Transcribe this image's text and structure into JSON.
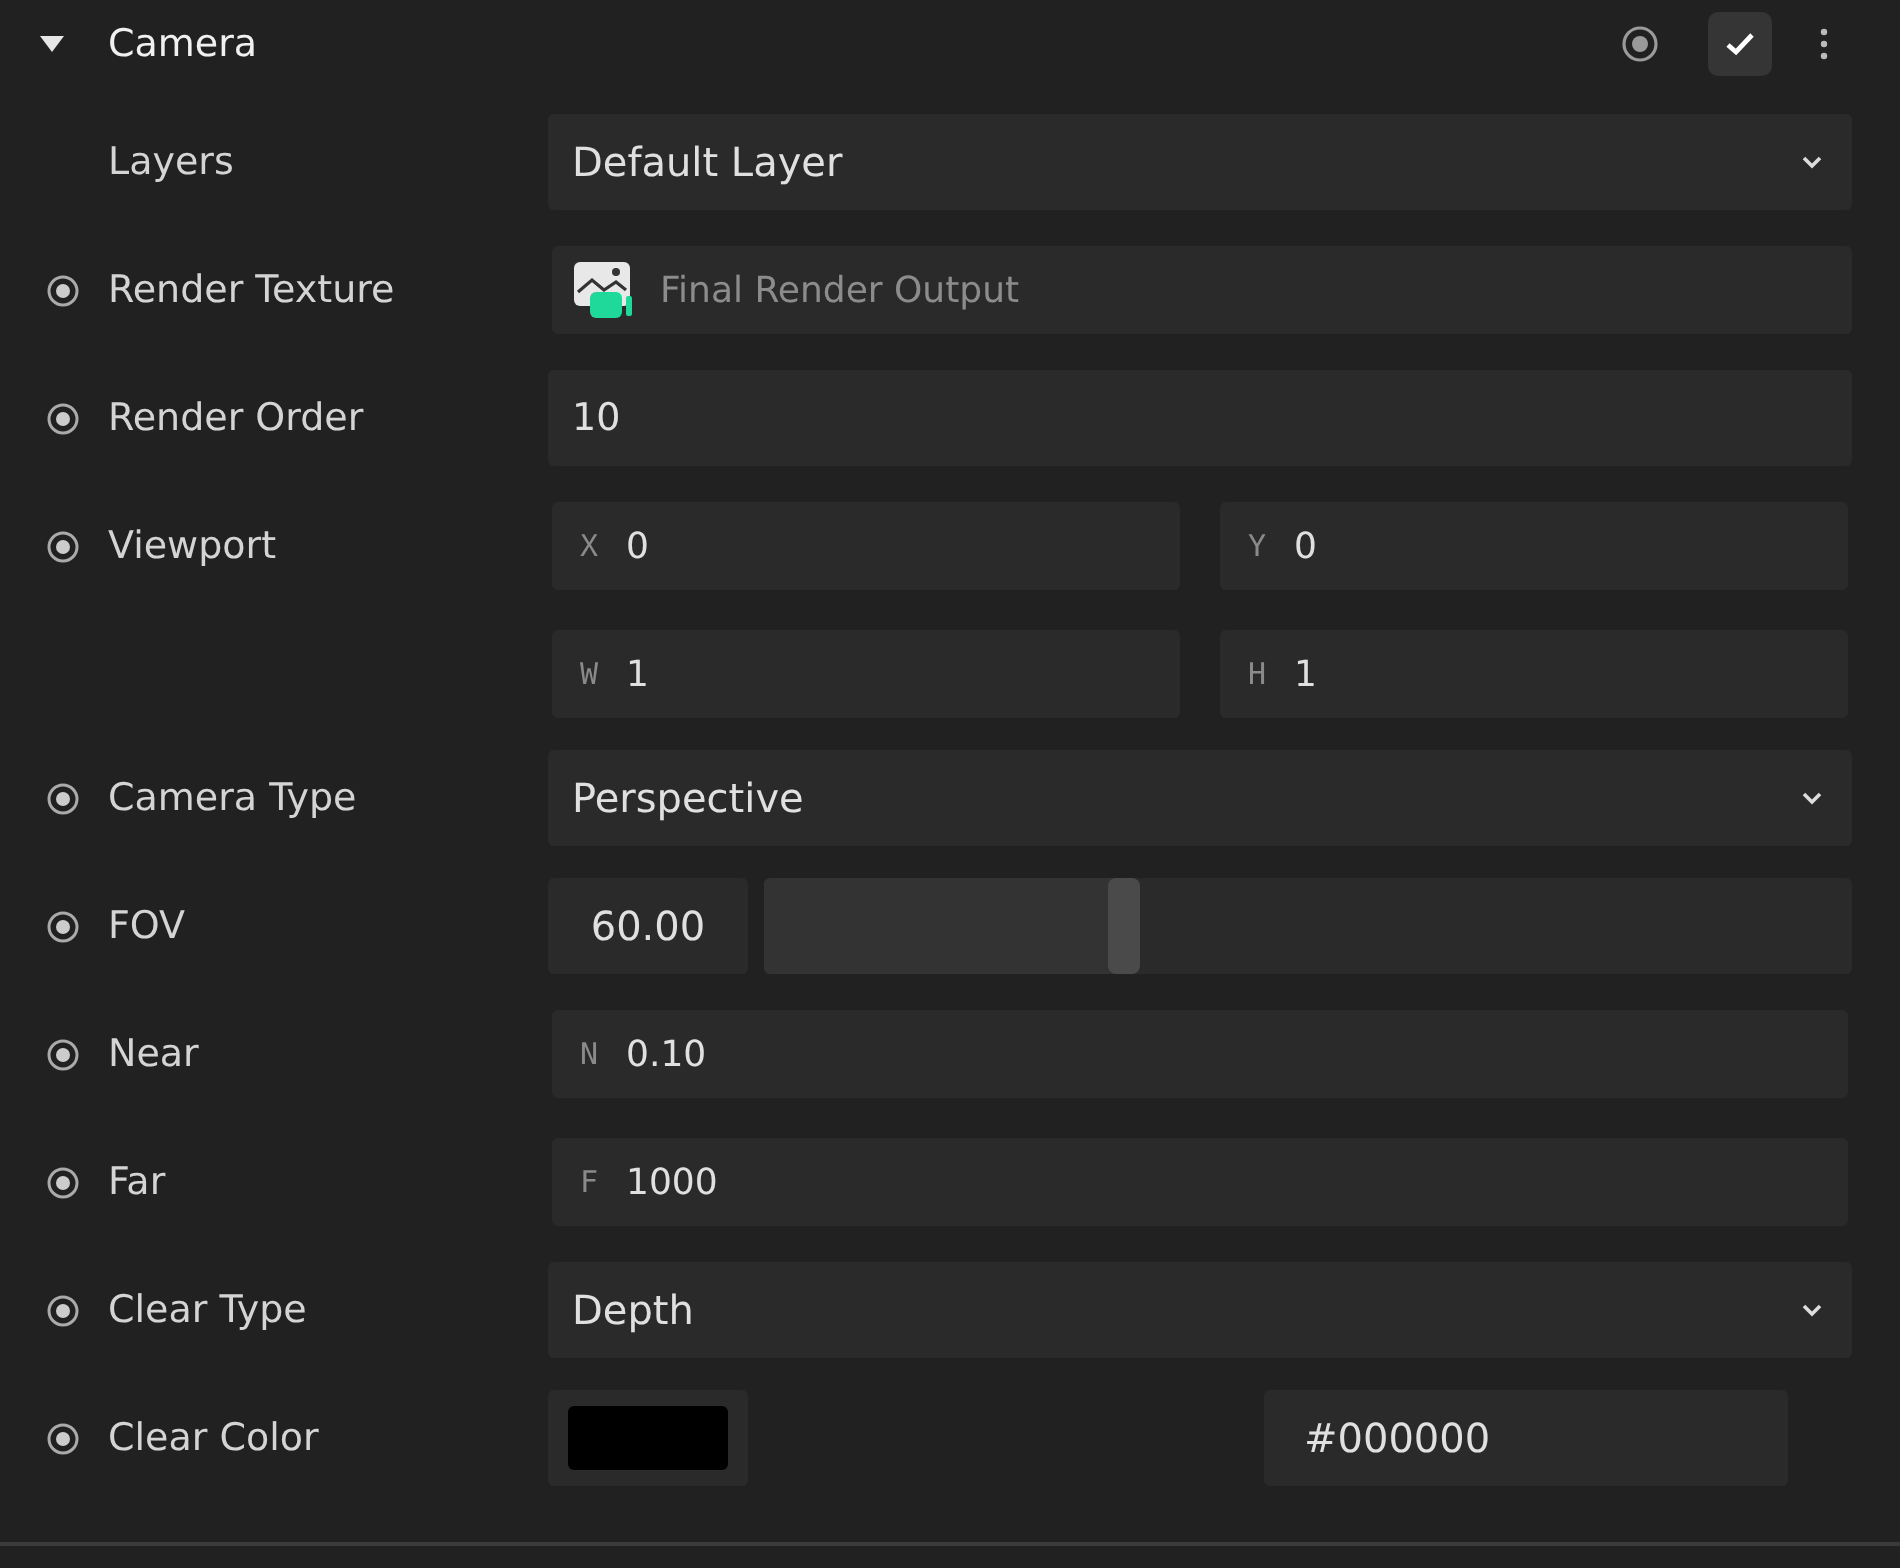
{
  "header": {
    "title": "Camera",
    "expanded": true,
    "enabled": true
  },
  "rows": [
    {
      "kind": "dropdown",
      "label": "Layers",
      "marker": false,
      "value": "Default Layer"
    },
    {
      "kind": "asset",
      "label": "Render Texture",
      "marker": true,
      "value": "Final Render Output"
    },
    {
      "kind": "number",
      "label": "Render Order",
      "marker": true,
      "value": "10"
    },
    {
      "kind": "vector",
      "label": "Viewport",
      "marker": true,
      "fields": [
        {
          "axis": "X",
          "value": "0"
        },
        {
          "axis": "Y",
          "value": "0"
        },
        {
          "axis": "W",
          "value": "1"
        },
        {
          "axis": "H",
          "value": "1"
        }
      ]
    },
    {
      "kind": "dropdown",
      "label": "Camera Type",
      "marker": true,
      "value": "Perspective"
    },
    {
      "kind": "slider",
      "label": "FOV",
      "marker": true,
      "value": "60.00",
      "level": 0.33
    },
    {
      "kind": "axis",
      "label": "Near",
      "marker": true,
      "axis": "N",
      "value": "0.10"
    },
    {
      "kind": "axis",
      "label": "Far",
      "marker": true,
      "axis": "F",
      "value": "1000"
    },
    {
      "kind": "dropdown",
      "label": "Clear Type",
      "marker": true,
      "value": "Depth"
    },
    {
      "kind": "color",
      "label": "Clear Color",
      "marker": true,
      "color": "#000000",
      "value": "#000000"
    }
  ]
}
